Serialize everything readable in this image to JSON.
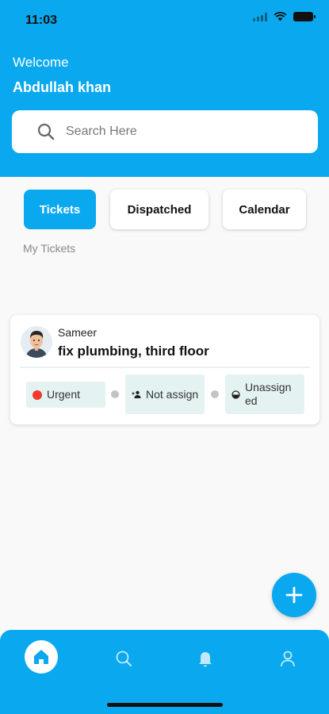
{
  "status_bar": {
    "time": "11:03"
  },
  "header": {
    "welcome": "Welcome",
    "username": "Abdullah khan",
    "search": {
      "placeholder": "Search Here",
      "value": ""
    }
  },
  "tabs": [
    {
      "label": "Tickets",
      "active": true
    },
    {
      "label": "Dispatched",
      "active": false
    },
    {
      "label": "Calendar",
      "active": false
    }
  ],
  "section_label": "My Tickets",
  "tickets": [
    {
      "name": "Sameer",
      "title": "fix plumbing, third floor",
      "priority": "Urgent",
      "assignment": "Not assign",
      "status": "Unassign ed"
    }
  ],
  "colors": {
    "accent": "#0aa8ef",
    "urgent": "#f23a2e",
    "chip_bg": "#e4f3f1"
  },
  "icons": {
    "search": "search-icon",
    "add": "plus-icon",
    "nav": [
      "home-icon",
      "search-icon",
      "bell-icon",
      "user-icon"
    ]
  }
}
